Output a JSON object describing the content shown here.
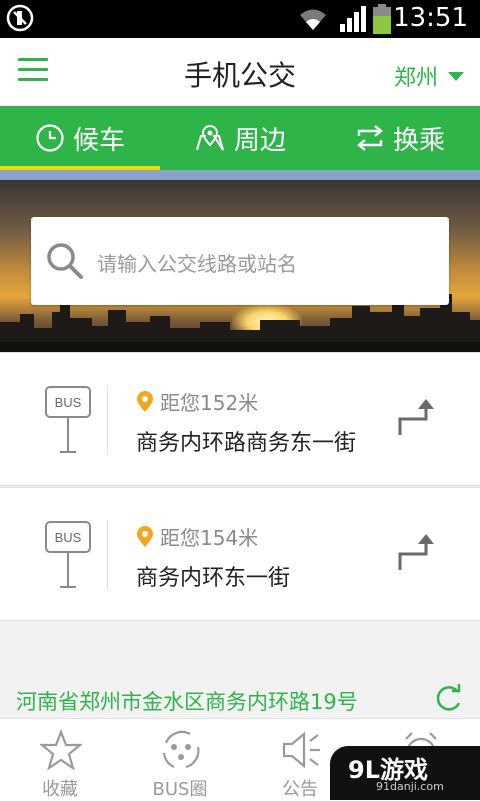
{
  "status_bar": {
    "time": "13:51"
  },
  "header": {
    "title": "手机公交",
    "city": "郑州"
  },
  "tabs": [
    {
      "label": "候车",
      "icon": "clock-icon",
      "active": true
    },
    {
      "label": "周边",
      "icon": "map-icon",
      "active": false
    },
    {
      "label": "换乘",
      "icon": "transfer-icon",
      "active": false
    }
  ],
  "search": {
    "placeholder": "请输入公交线路或站名"
  },
  "stations": [
    {
      "badge": "BUS",
      "distance": "距您152米",
      "name": "商务内环路商务东一街"
    },
    {
      "badge": "BUS",
      "distance": "距您154米",
      "name": "商务内环东一街"
    }
  ],
  "location": {
    "address": "河南省郑州市金水区商务内环路19号"
  },
  "bottom_nav": [
    {
      "label": "收藏",
      "icon": "star-icon"
    },
    {
      "label": "BUS圈",
      "icon": "bus-circle-icon"
    },
    {
      "label": "公告",
      "icon": "speaker-icon"
    },
    {
      "label": "",
      "icon": "alarm-icon"
    }
  ],
  "watermark": {
    "brand": "9L游戏",
    "site": "91danji.com"
  },
  "colors": {
    "primary": "#2fb44a",
    "tab_indicator": "#f2d900",
    "accent_pin": "#f3a51d"
  }
}
